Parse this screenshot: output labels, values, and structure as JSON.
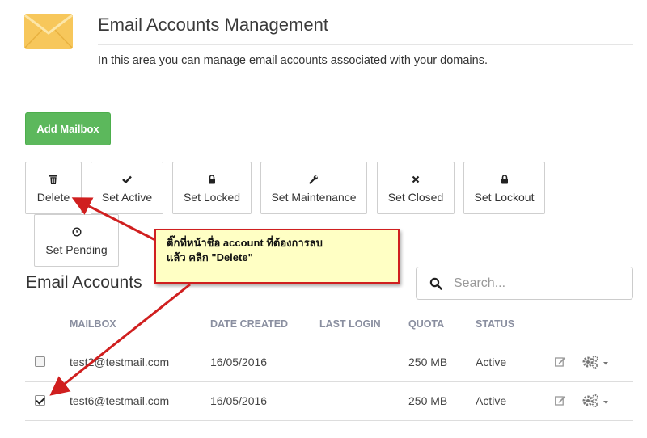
{
  "header": {
    "title": "Email Accounts Management",
    "description": "In this area you can manage email accounts associated with your domains."
  },
  "add_mailbox_label": "Add Mailbox",
  "actions": [
    {
      "label": "Delete",
      "icon": "trash-icon"
    },
    {
      "label": "Set Active",
      "icon": "check-icon"
    },
    {
      "label": "Set Locked",
      "icon": "lock-icon"
    },
    {
      "label": "Set Maintenance",
      "icon": "wrench-icon"
    },
    {
      "label": "Set Closed",
      "icon": "times-icon"
    },
    {
      "label": "Set Lockout",
      "icon": "lock-icon"
    },
    {
      "label": "Set Pending",
      "icon": "clock-icon"
    }
  ],
  "accounts_title": "Email Accounts",
  "search": {
    "placeholder": "Search..."
  },
  "table": {
    "columns": [
      "MAILBOX",
      "DATE CREATED",
      "LAST LOGIN",
      "QUOTA",
      "STATUS"
    ],
    "rows": [
      {
        "checked": false,
        "mailbox": "test2@testmail.com",
        "date_created": "16/05/2016",
        "last_login": "",
        "quota": "250 MB",
        "status": "Active"
      },
      {
        "checked": true,
        "mailbox": "test6@testmail.com",
        "date_created": "16/05/2016",
        "last_login": "",
        "quota": "250 MB",
        "status": "Active"
      }
    ]
  },
  "callout": {
    "line1": "ติ๊กที่หน้าชื่อ account ที่ต้องการลบ",
    "line2": "แล้ว คลิก \"Delete\""
  },
  "colors": {
    "primary_button": "#5cb85c",
    "callout_bg": "#ffffc4",
    "arrow": "#d01f1f",
    "envelope": "#f7c75b"
  }
}
